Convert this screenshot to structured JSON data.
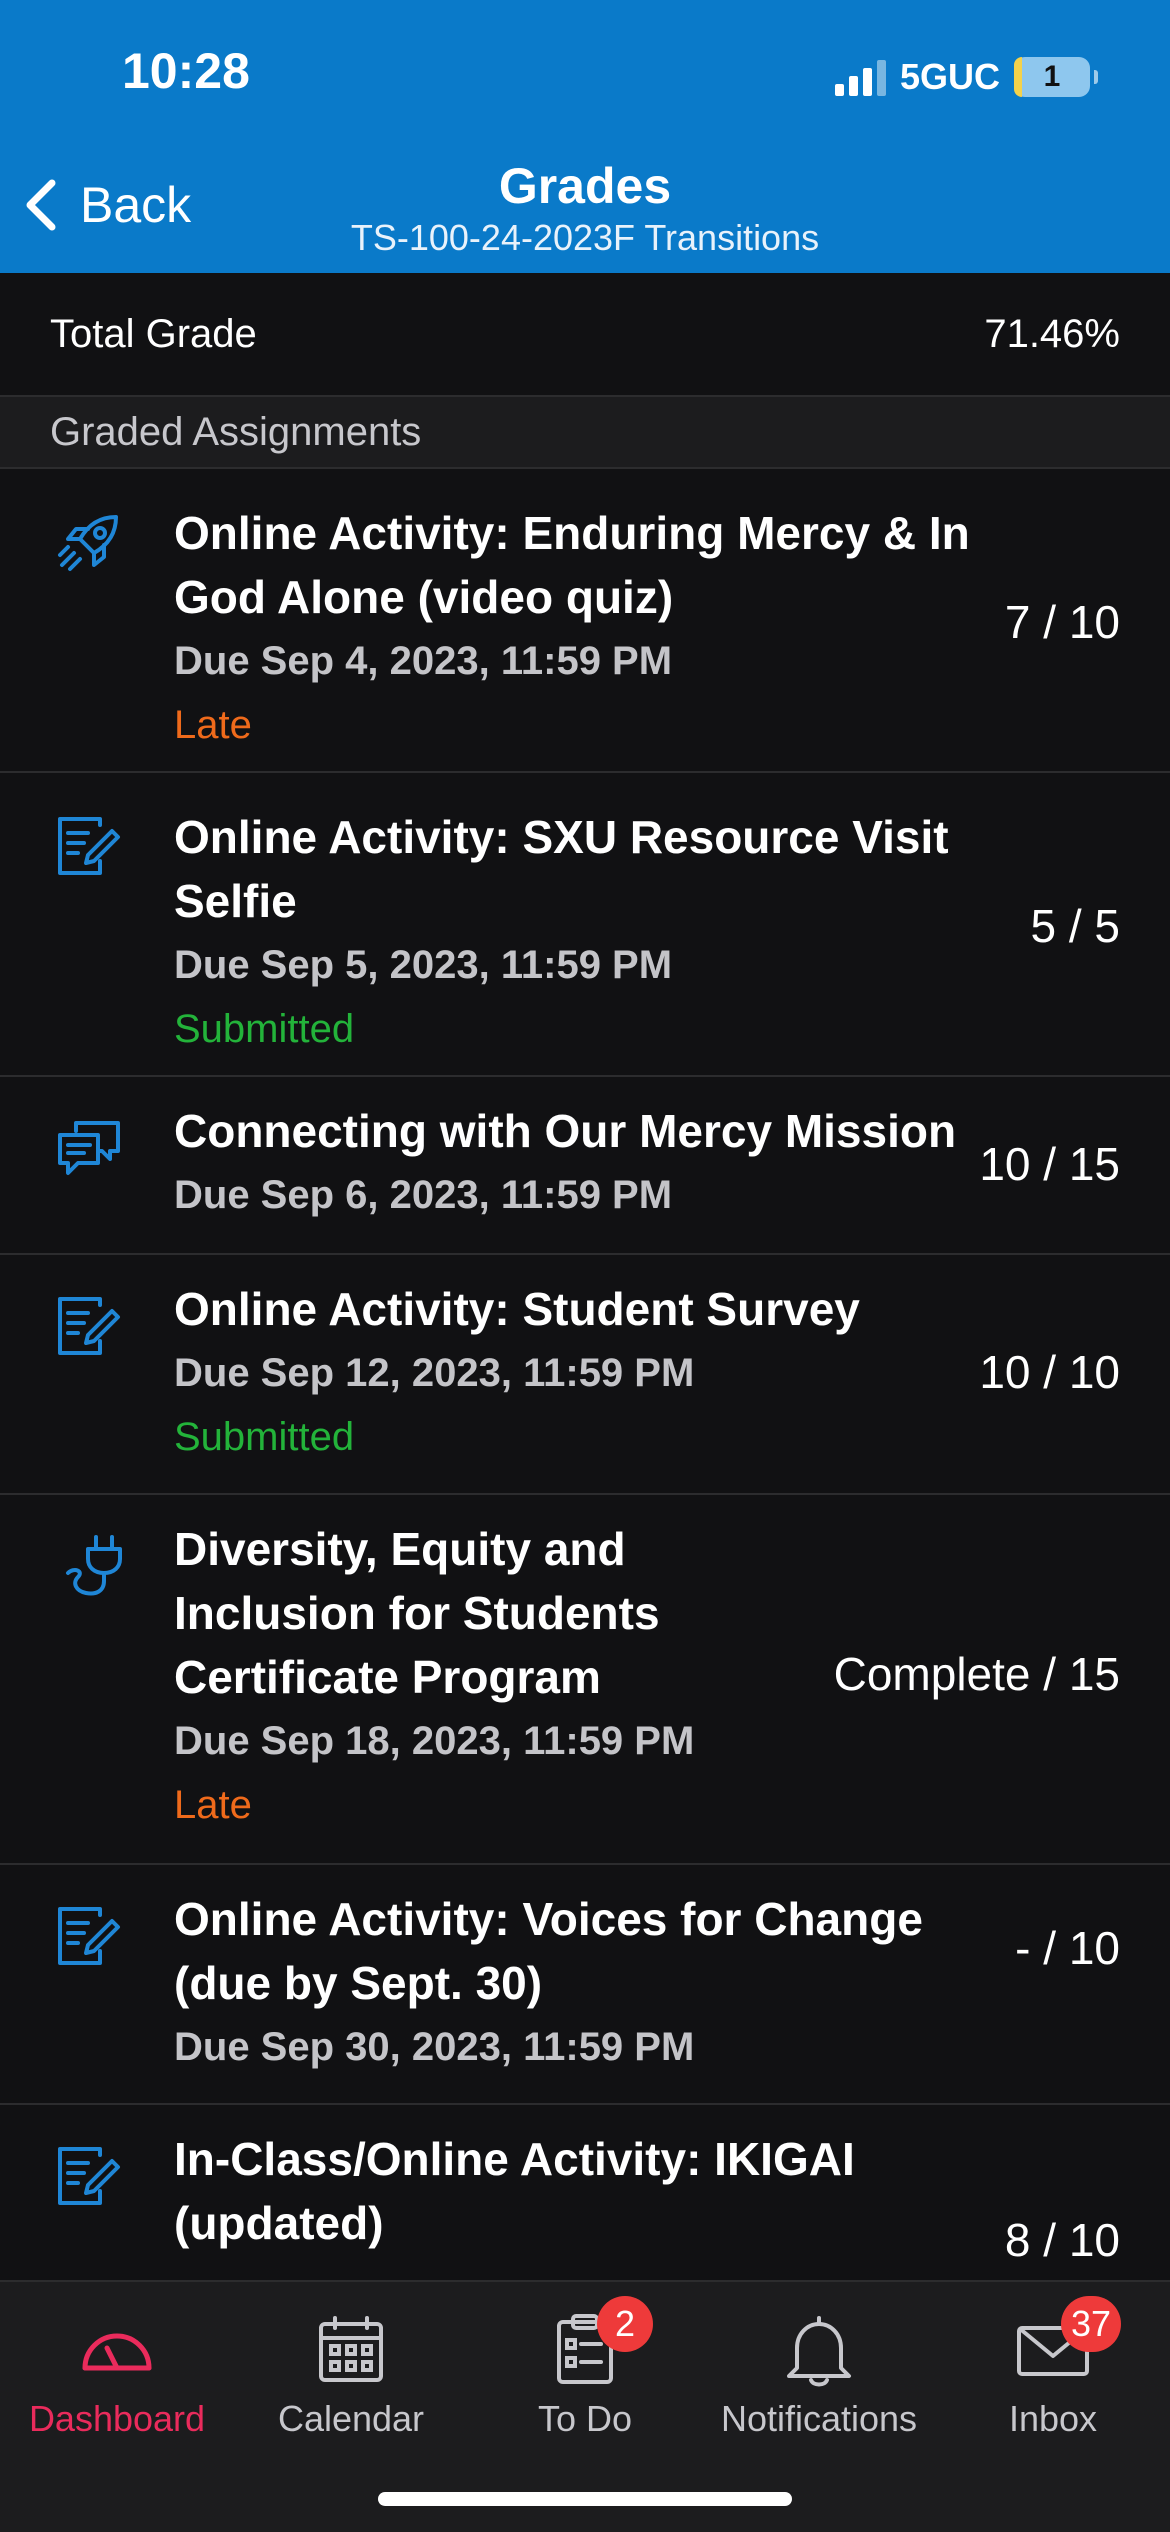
{
  "status_bar": {
    "time": "10:28",
    "network": "5GUC",
    "battery": "1"
  },
  "nav": {
    "back_label": "Back",
    "title": "Grades",
    "subtitle": "TS-100-24-2023F Transitions"
  },
  "total": {
    "label": "Total Grade",
    "value": "71.46%"
  },
  "section": {
    "label": "Graded Assignments"
  },
  "assignments": [
    {
      "icon": "rocket-icon",
      "title": "Online Activity: Enduring Mercy  & In God Alone (video quiz)",
      "due": "Due Sep 4, 2023, 11:59 PM",
      "status": "Late",
      "score": "7 / 10"
    },
    {
      "icon": "assignment-edit-icon",
      "title": "Online Activity: SXU Resource Visit Selfie",
      "due": "Due Sep 5, 2023, 11:59 PM",
      "status": "Submitted",
      "score": "5 / 5"
    },
    {
      "icon": "discussion-icon",
      "title": "Connecting with Our Mercy Mission",
      "due": "Due Sep 6, 2023, 11:59 PM",
      "status": "",
      "score": "10 / 15"
    },
    {
      "icon": "assignment-edit-icon",
      "title": "Online Activity: Student Survey",
      "due": "Due Sep 12, 2023, 11:59 PM",
      "status": "Submitted",
      "score": "10 / 10"
    },
    {
      "icon": "plug-icon",
      "title": "Diversity, Equity and Inclusion for Students Certificate Program",
      "due": "Due Sep 18, 2023, 11:59 PM",
      "status": "Late",
      "score": "Complete / 15"
    },
    {
      "icon": "assignment-edit-icon",
      "title": "Online Activity: Voices for Change (due by Sept. 30)",
      "due": "Due Sep 30, 2023, 11:59 PM",
      "status": "",
      "score": "- / 10"
    },
    {
      "icon": "assignment-edit-icon",
      "title": "In-Class/Online Activity: IKIGAI (updated)",
      "due": "",
      "status": "",
      "score": "8 / 10"
    }
  ],
  "tabs": [
    {
      "label": "Dashboard",
      "icon": "dashboard-gauge-icon",
      "active": true,
      "badge": ""
    },
    {
      "label": "Calendar",
      "icon": "calendar-icon",
      "active": false,
      "badge": ""
    },
    {
      "label": "To Do",
      "icon": "todo-clipboard-icon",
      "active": false,
      "badge": "2"
    },
    {
      "label": "Notifications",
      "icon": "bell-icon",
      "active": false,
      "badge": ""
    },
    {
      "label": "Inbox",
      "icon": "mail-icon",
      "active": false,
      "badge": "37"
    }
  ],
  "colors": {
    "header_bg": "#0a7ac9",
    "icon_blue": "#1f86d6",
    "late": "#ef6a1b",
    "submitted": "#23b33a",
    "active_tab": "#ea2b5c",
    "badge": "#ee3a3a"
  }
}
